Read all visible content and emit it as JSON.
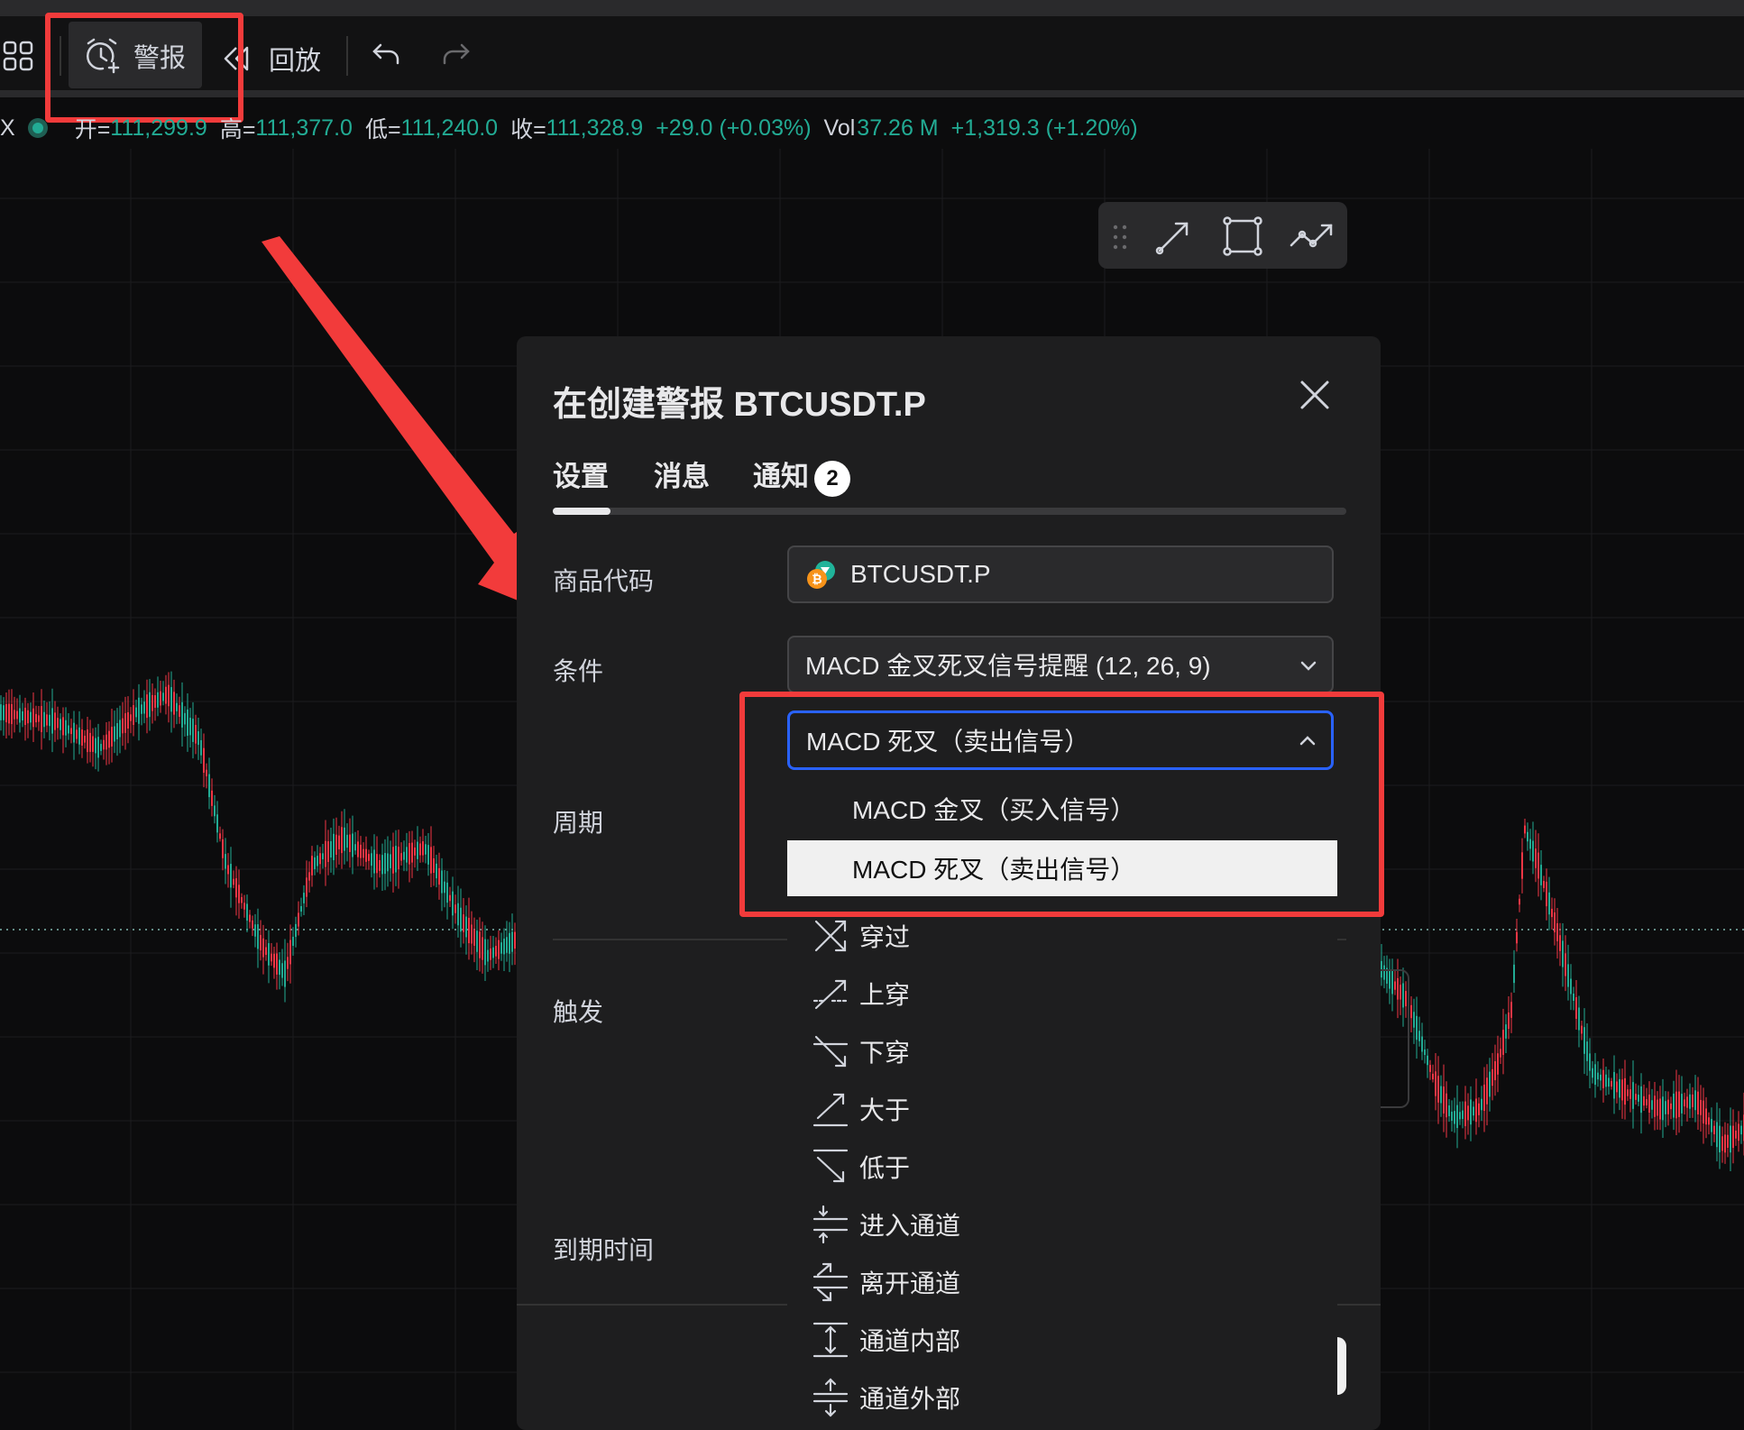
{
  "toolbar": {
    "alert_label": "警报",
    "replay_label": "回放"
  },
  "ohlc": {
    "symbol_tail": "X",
    "open_label": "开=",
    "open_value": "111,299.9",
    "high_label": "高=",
    "high_value": "111,377.0",
    "low_label": "低=",
    "low_value": "111,240.0",
    "close_label": "收=",
    "close_value": "111,328.9",
    "change": "+29.0 (+0.03%)",
    "vol_label": "Vol",
    "vol_value": "37.26 M",
    "vol_change": "+1,319.3 (+1.20%)"
  },
  "dialog": {
    "title": "在创建警报 BTCUSDT.P",
    "tabs": [
      {
        "label": "设置"
      },
      {
        "label": "消息"
      },
      {
        "label": "通知",
        "badge": "2"
      }
    ],
    "fields": {
      "symbol_label": "商品代码",
      "symbol_value": "BTCUSDT.P",
      "condition_label": "条件",
      "condition_value": "MACD 金叉死叉信号提醒 (12, 26, 9)",
      "signal_value": "MACD 死叉（卖出信号）",
      "period_label": "周期",
      "trigger_label": "触发",
      "expiry_label": "到期时间"
    },
    "dropdown_options": [
      {
        "label": "MACD 金叉（买入信号）",
        "selected": false
      },
      {
        "label": "MACD 死叉（卖出信号）",
        "selected": true
      }
    ],
    "operators": [
      {
        "label": "穿过",
        "icon": "crossing-icon"
      },
      {
        "label": "上穿",
        "icon": "crossing-up-icon"
      },
      {
        "label": "下穿",
        "icon": "crossing-down-icon"
      },
      {
        "label": "大于",
        "icon": "greater-than-icon"
      },
      {
        "label": "低于",
        "icon": "less-than-icon"
      },
      {
        "label": "进入通道",
        "icon": "entering-channel-icon"
      },
      {
        "label": "离开通道",
        "icon": "exiting-channel-icon"
      },
      {
        "label": "通道内部",
        "icon": "inside-channel-icon"
      },
      {
        "label": "通道外部",
        "icon": "outside-channel-icon"
      }
    ]
  },
  "colors": {
    "up": "#22ab94",
    "down": "#f23645",
    "highlight": "#f23b3b",
    "focus": "#2962ff"
  }
}
